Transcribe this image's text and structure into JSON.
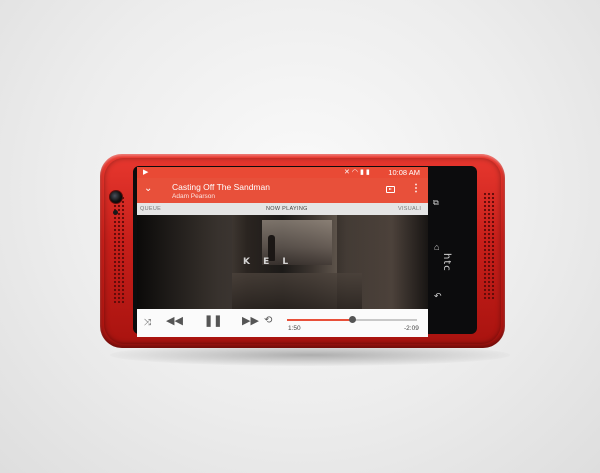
{
  "device": {
    "brand": "htc",
    "color": "#d42a22"
  },
  "status_bar": {
    "time": "10:08",
    "period": "AM",
    "left_icon": "play-notification-icon",
    "right_icons": [
      "mute-icon",
      "wifi-icon",
      "signal-icon",
      "battery-icon"
    ]
  },
  "player": {
    "song_title": "Casting Off The Sandman",
    "artist": "Adam Pearson",
    "accent_color": "#e8503a",
    "tabs": [
      {
        "label": "QUEUE"
      },
      {
        "label": "NOW PLAYING"
      },
      {
        "label": "VISUALI"
      }
    ],
    "album_art_text": "K E L",
    "controls": {
      "shuffle": "⤨",
      "previous": "◀◀",
      "pause": "❚❚",
      "next": "▶▶",
      "repeat": "⟲"
    },
    "progress": {
      "elapsed": "1:50",
      "remaining": "-2:09",
      "fraction": 0.5
    }
  },
  "nav_buttons": [
    "recent-apps-icon",
    "home-icon",
    "back-icon"
  ]
}
